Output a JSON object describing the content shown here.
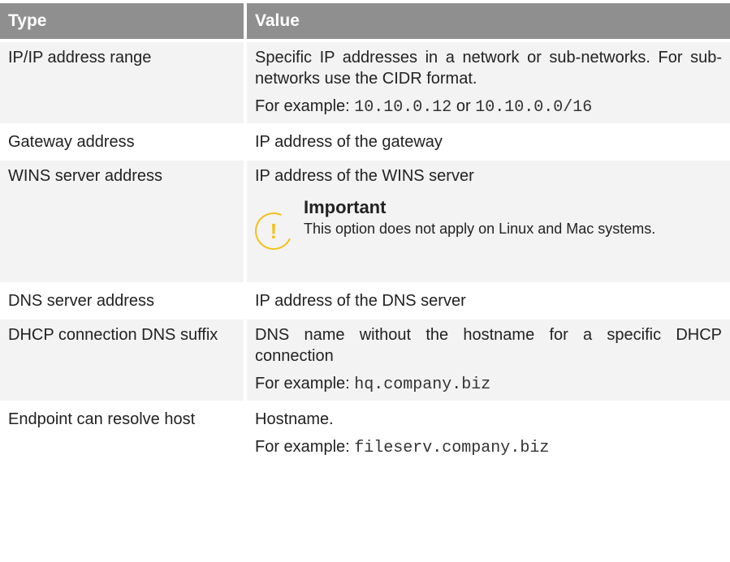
{
  "table": {
    "headers": {
      "type": "Type",
      "value": "Value"
    },
    "rows": {
      "ip": {
        "type": "IP/IP address range",
        "value": "Specific IP addresses in a network or sub-networks. For sub-networks use the CIDR format.",
        "example_prefix": "For example:",
        "example_code1": "10.10.0.12",
        "example_or": "or",
        "example_code2": "10.10.0.0/16"
      },
      "gateway": {
        "type": "Gateway address",
        "value": "IP address of the gateway"
      },
      "wins": {
        "type": "WINS server address",
        "value": "IP address of the WINS server",
        "note_title": "Important",
        "note_text": "This option does not apply on Linux and Mac systems.",
        "note_icon": "exclamation-icon",
        "note_glyph": "!"
      },
      "dns": {
        "type": "DNS server address",
        "value": "IP address of the DNS server"
      },
      "dhcp": {
        "type": "DHCP connection DNS suffix",
        "value": "DNS name without the hostname for a specific DHCP connection",
        "example_prefix": "For example:",
        "example_code": "hq.company.biz"
      },
      "endpoint": {
        "type": "Endpoint can resolve host",
        "value": "Hostname.",
        "example_prefix": "For example:",
        "example_code": "fileserv.company.biz"
      }
    }
  },
  "colors": {
    "header_bg": "#8f8f8f",
    "row_alt_bg": "#f3f3f3",
    "warning_accent": "#f2c21b"
  }
}
